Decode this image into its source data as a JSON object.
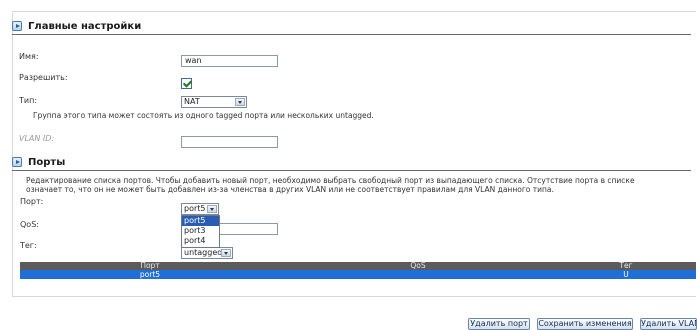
{
  "main_settings": {
    "title": "Главные настройки",
    "name_label": "Имя:",
    "name_value": "wan",
    "enable_label": "Разрешить:",
    "enable_checked": true,
    "type_label": "Тип:",
    "type_value": "NAT",
    "type_note": "Группа этого типа может состоять из одного tagged порта или нескольких untagged.",
    "vlan_id_label": "VLAN ID:",
    "vlan_id_value": ""
  },
  "ports": {
    "title": "Порты",
    "description_line1": "Редактирование списка портов. Чтобы добавить новый порт, необходимо выбрать свободный порт из выпадающего списка. Отсутствие порта в списке",
    "description_line2": "означает то, что он не может быть добавлен из-за членства в других VLAN или не соответствует правилам для VLAN данного типа.",
    "port_label": "Порт:",
    "port_value": "port5",
    "port_options": [
      "port5",
      "port3",
      "port4"
    ],
    "port_highlighted": "port5",
    "qos_label": "QoS:",
    "qos_value": "",
    "tag_label": "Тег:",
    "tag_value": "untagged"
  },
  "table": {
    "headers": [
      "Порт",
      "QoS",
      "Тег"
    ],
    "rows": [
      {
        "port": "port5",
        "qos": "",
        "tag": "U"
      }
    ]
  },
  "buttons": {
    "delete_port": "Удалить порт",
    "save_changes": "Сохранить изменения",
    "delete_vlan": "Удалить VLAN"
  },
  "colors": {
    "selected_row": "#1f6fd6",
    "table_header": "#5b5b5b",
    "dropdown_highlight": "#2a5db0"
  }
}
